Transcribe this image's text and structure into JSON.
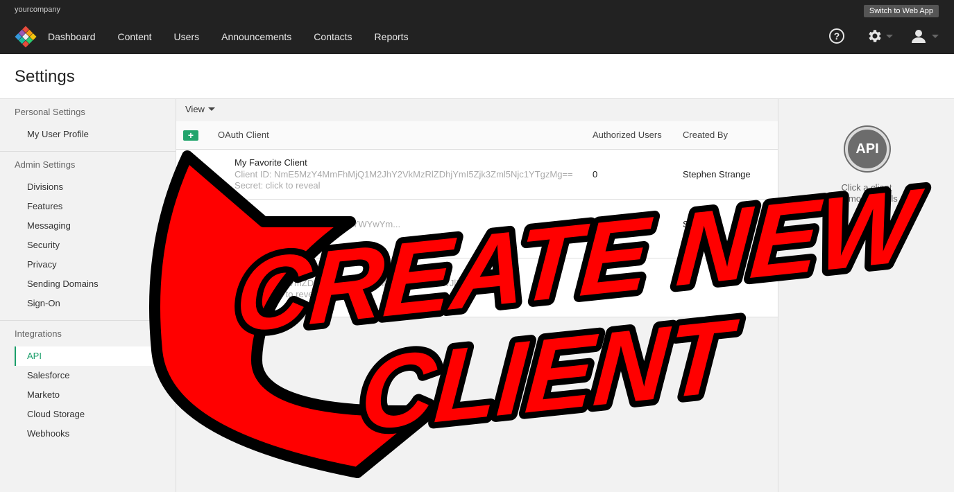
{
  "topbar": {
    "company": "yourcompany",
    "switch_label": "Switch to Web App",
    "nav": [
      "Dashboard",
      "Content",
      "Users",
      "Announcements",
      "Contacts",
      "Reports"
    ],
    "help_label": "?"
  },
  "header": {
    "title": "Settings"
  },
  "sidebar": {
    "personal": {
      "heading": "Personal Settings",
      "items": [
        "My User Profile"
      ]
    },
    "admin": {
      "heading": "Admin Settings",
      "items": [
        "Divisions",
        "Features",
        "Messaging",
        "Security",
        "Privacy",
        "Sending Domains",
        "Sign-On"
      ]
    },
    "integrations": {
      "heading": "Integrations",
      "items": [
        "API",
        "Salesforce",
        "Marketo",
        "Cloud Storage",
        "Webhooks"
      ],
      "active": "API"
    }
  },
  "main": {
    "view_label": "View",
    "add_label": "+",
    "columns": {
      "client": "OAuth Client",
      "users": "Authorized Users",
      "created_by": "Created By"
    },
    "rows": [
      {
        "name": "My Favorite Client",
        "client_id": "Client ID: NmE5MzY4MmFhMjQ1M2JhY2VkMzRlZDhjYmI5Zjk3Zml5Njc1YTgzMg==",
        "reveal": "Secret: click to reveal",
        "users": "0",
        "created_by": "Stephen Strange"
      },
      {
        "name": "",
        "client_id": "Client ID: ...wZTBiODJlZmMxYWYwYm...",
        "reveal": "Secret: click to reveal",
        "users": "",
        "created_by": "S..."
      },
      {
        "name": "",
        "client_id": "Client ID: ...DVmZDQ3YWVlMzIwZjdiMWY0ZTQ5OWJlZDY5MmEw...",
        "reveal": "Secret: click to reveal",
        "users": "",
        "created_by": ""
      }
    ]
  },
  "right_panel": {
    "badge": "API",
    "hint_line1": "Click a client",
    "hint_line2": "for more details"
  },
  "overlay": {
    "line1": "CREATE NEW",
    "line2": "CLIENT"
  },
  "colors": {
    "accent": "#1a9e6a",
    "overlay_red": "#ff0000",
    "topbar": "#222222"
  }
}
